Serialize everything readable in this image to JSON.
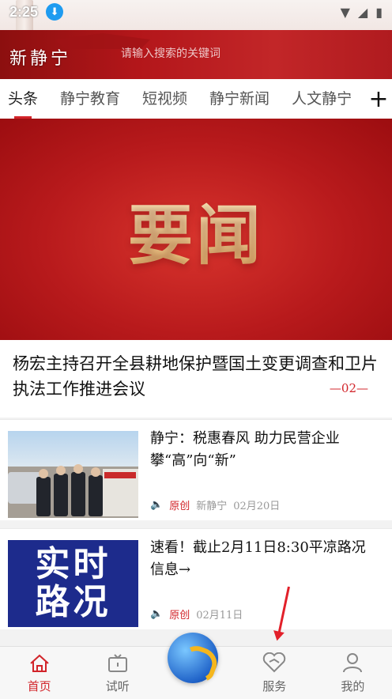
{
  "status_bar": {
    "time": "2:25"
  },
  "header": {
    "logo": "新静宁",
    "search_placeholder": "请输入搜索的关键词"
  },
  "tabs": [
    "头条",
    "静宁教育",
    "短视频",
    "静宁新闻",
    "人文静宁"
  ],
  "banner": {
    "title": "要闻"
  },
  "headline": {
    "text": "杨宏主持召开全县耕地保护暨国土变更调查和卫片执法工作推进会议",
    "pager": "—02—"
  },
  "news": [
    {
      "title": "静宁：税惠春风 助力民营企业攀“高”向“新”",
      "tag": "原创",
      "source": "新静宁",
      "date": "02月20日"
    },
    {
      "title": "速看！截止2月11日8:30平凉路况信息→",
      "tag": "原创",
      "date": "02月11日",
      "thumb_text": [
        "实时",
        "路况"
      ]
    }
  ],
  "bottom_nav": [
    "首页",
    "试听",
    "",
    "服务",
    "我的"
  ],
  "colors": {
    "accent": "#d2242a"
  }
}
